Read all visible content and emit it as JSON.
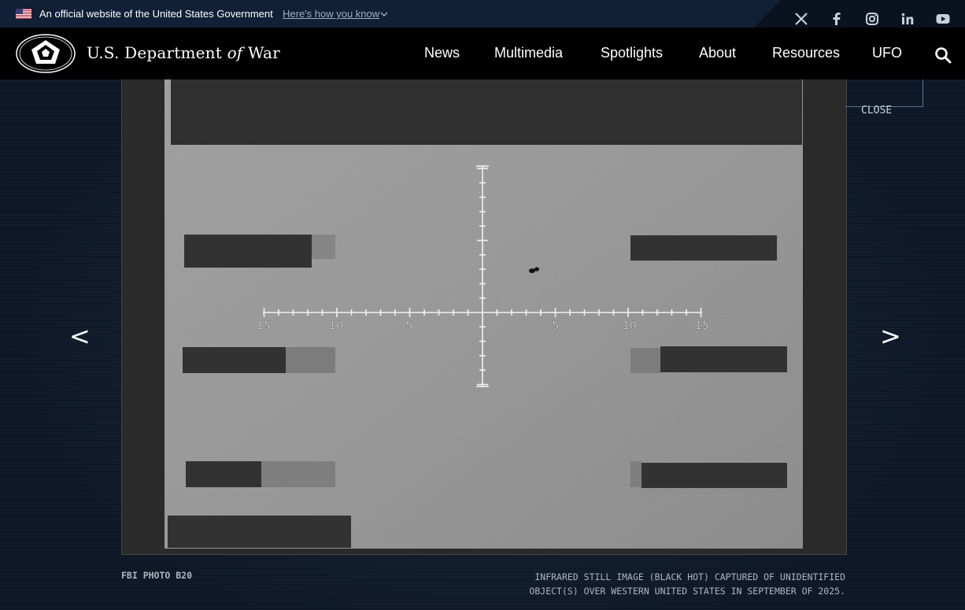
{
  "gov_banner": {
    "text": "An official website of the United States Government",
    "link": "Here's how you know"
  },
  "header": {
    "title_prefix": "U.S. Department",
    "title_of": "of",
    "title_suffix": "War",
    "nav": [
      "News",
      "Multimedia",
      "Spotlights",
      "About",
      "Resources",
      "UFO"
    ]
  },
  "social": [
    "x-icon",
    "facebook-icon",
    "instagram-icon",
    "linkedin-icon",
    "youtube-icon"
  ],
  "viewer": {
    "close_label": "CLOSE",
    "prev_label": "<",
    "next_label": ">",
    "reticle_labels": [
      "15",
      "10",
      "5",
      "5",
      "10",
      "15"
    ]
  },
  "caption": {
    "credit": "FBI PHOTO B20",
    "description_line1": "INFRARED STILL IMAGE (BLACK HOT) CAPTURED OF UNIDENTIFIED",
    "description_line2": "OBJECT(S) OVER WESTERN UNITED STATES IN SEPTEMBER OF 2025."
  },
  "colors": {
    "gov_bar": "#112037",
    "header": "#000000",
    "page_bg": "#0c1625",
    "ir_background": "#9a9a9a"
  }
}
